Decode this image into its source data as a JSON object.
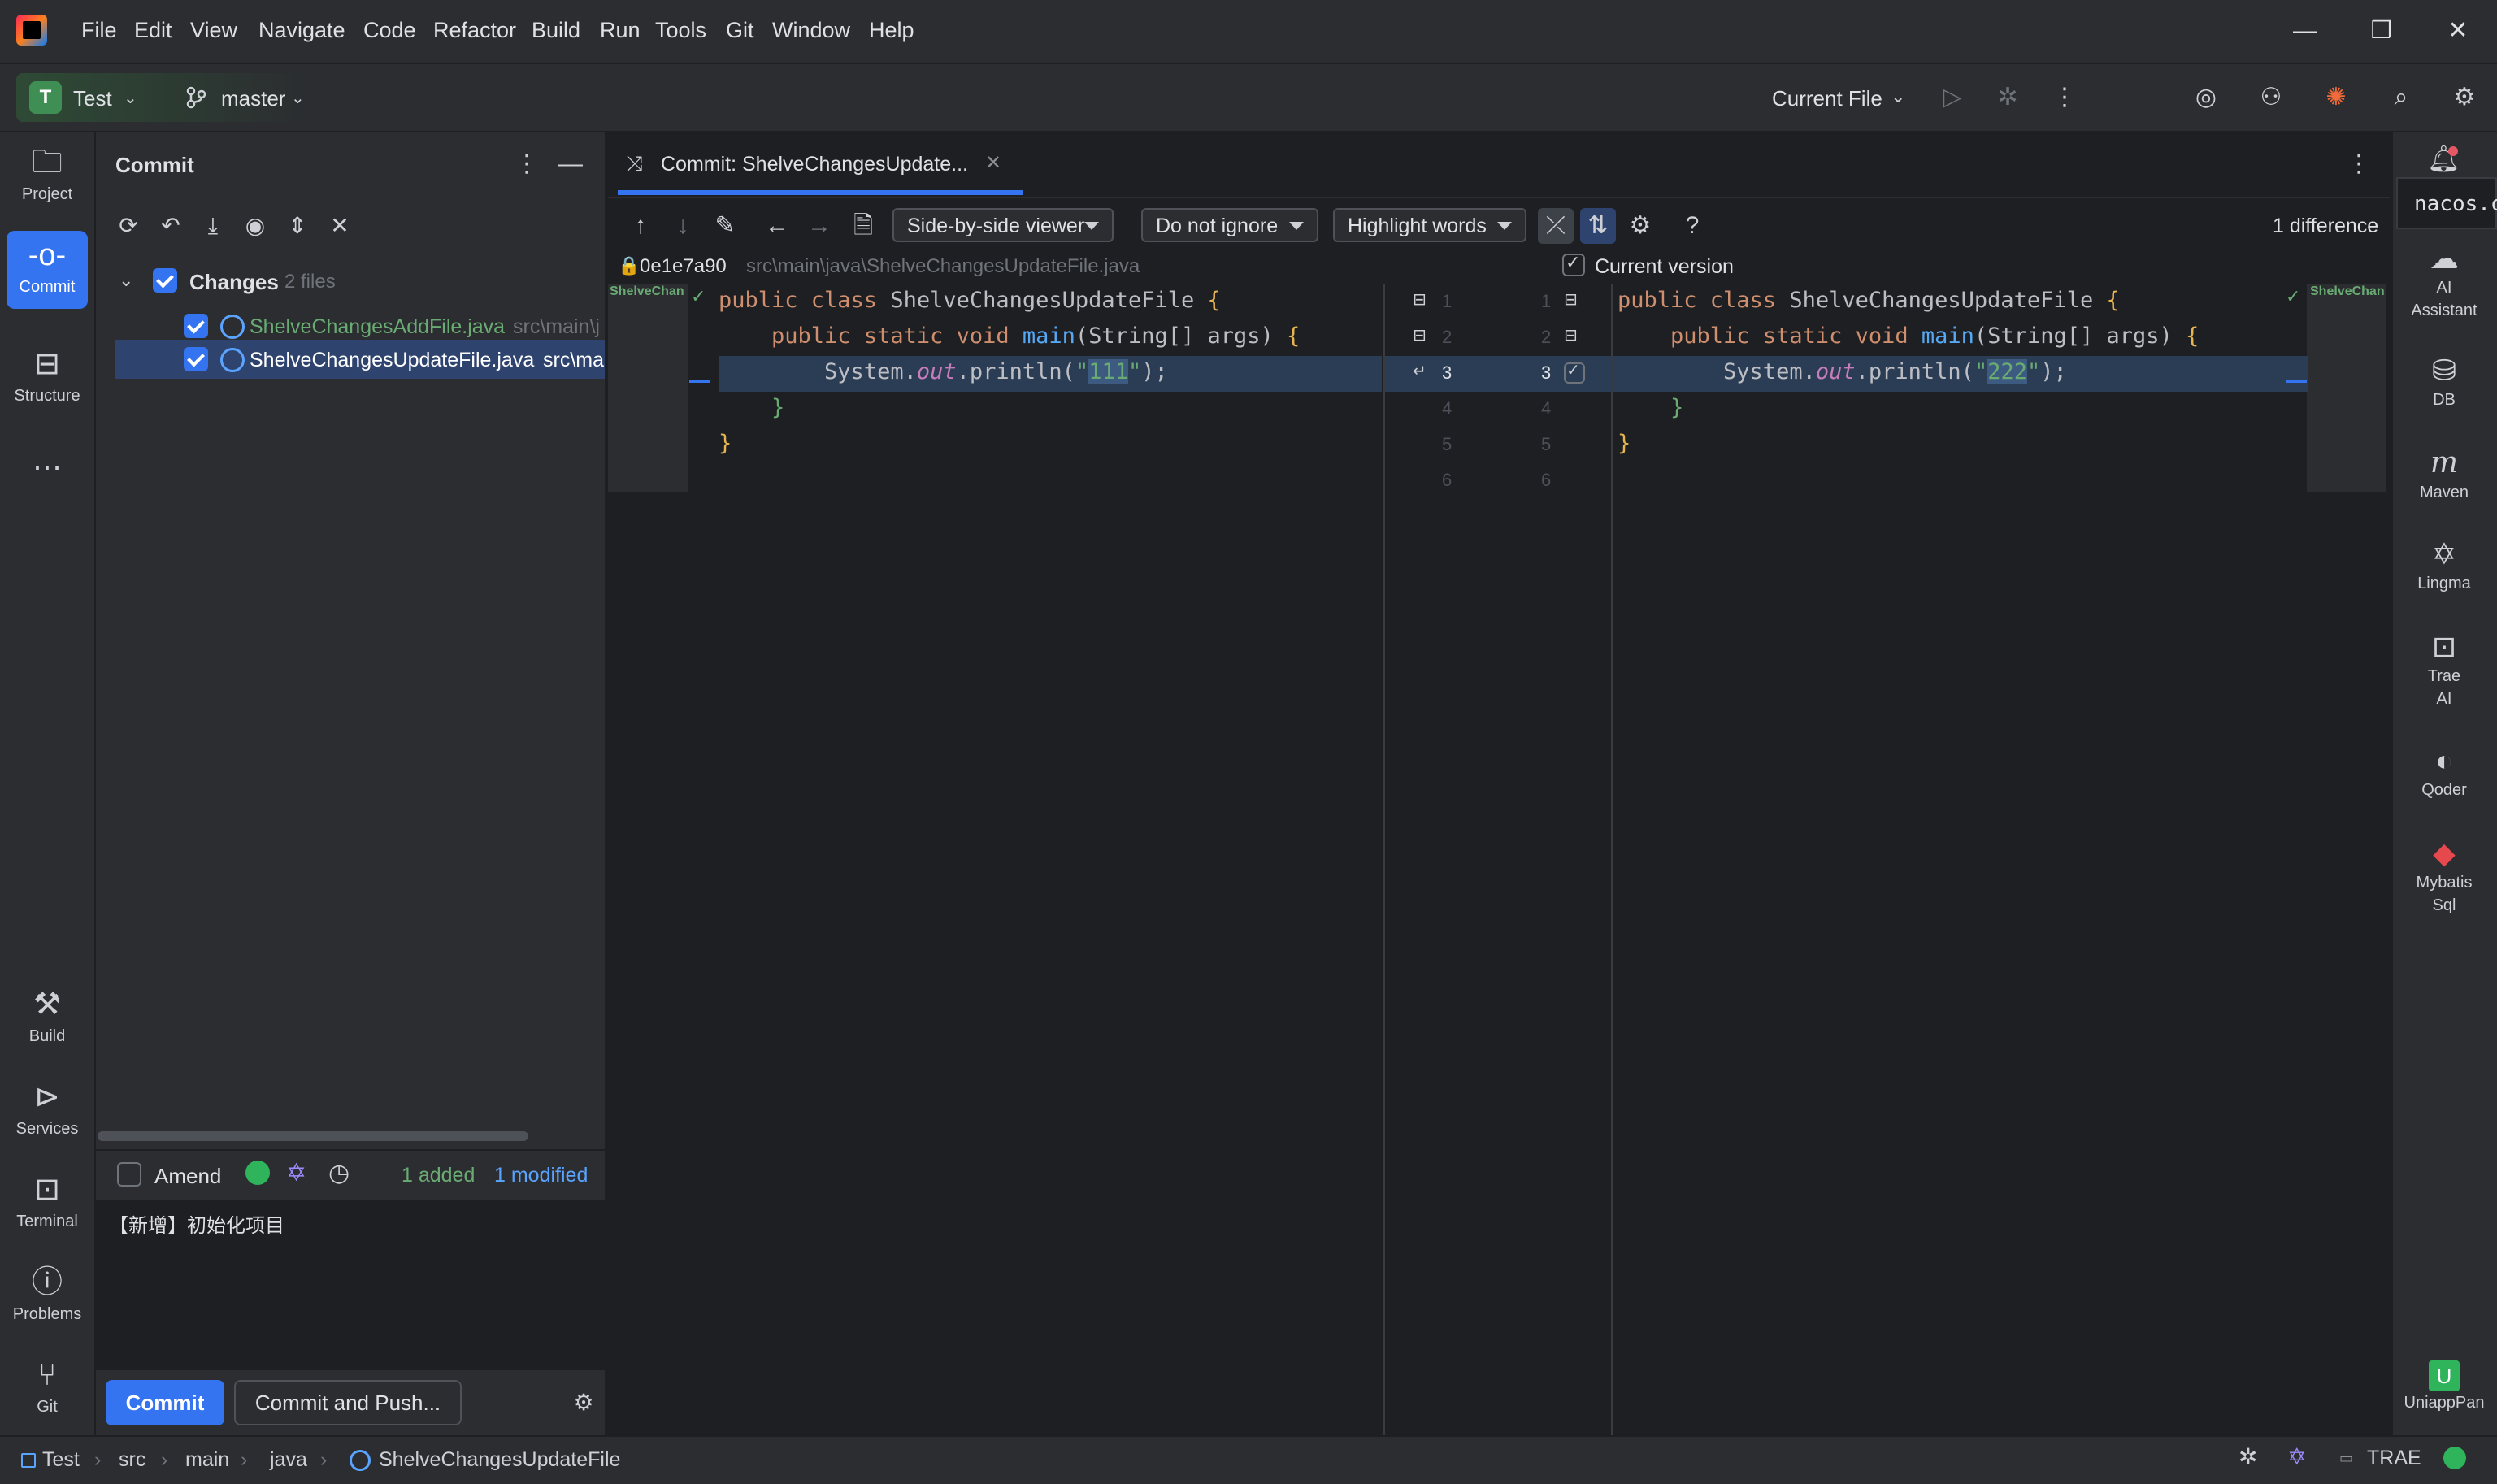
{
  "menu": [
    "File",
    "Edit",
    "View",
    "Navigate",
    "Code",
    "Refactor",
    "Build",
    "Run",
    "Tools",
    "Git",
    "Window",
    "Help"
  ],
  "window_controls": {
    "minimize": "—",
    "restore": "❐",
    "close": "✕"
  },
  "toolbar": {
    "project_badge": "T",
    "project_name": "Test",
    "branch": "master",
    "run_config": "Current File"
  },
  "left_rail": {
    "top": [
      {
        "label": "Project",
        "icon": "folder-icon"
      },
      {
        "label": "Commit",
        "icon": "commit-icon"
      },
      {
        "label": "Structure",
        "icon": "structure-icon"
      },
      {
        "label": "…",
        "icon": "more-icon"
      }
    ],
    "bottom": [
      {
        "label": "Build",
        "icon": "hammer-icon"
      },
      {
        "label": "Services",
        "icon": "services-icon"
      },
      {
        "label": "Terminal",
        "icon": "terminal-icon"
      },
      {
        "label": "Problems",
        "icon": "problems-icon"
      },
      {
        "label": "Git",
        "icon": "git-icon"
      }
    ]
  },
  "commit_panel": {
    "title": "Commit",
    "changes_label": "Changes",
    "changes_count": "2 files",
    "files": [
      {
        "name": "ShelveChangesAddFile.java",
        "path": "src\\main\\j",
        "status_color": "#6aab73"
      },
      {
        "name": "ShelveChangesUpdateFile.java",
        "path": "src\\ma",
        "status_color": "#ffffff"
      }
    ],
    "amend_label": "Amend",
    "added": "1 added",
    "modified": "1 modified",
    "message": "【新增】初始化项目",
    "commit_button": "Commit",
    "commit_push_button": "Commit and Push..."
  },
  "diff": {
    "tab_title": "Commit: ShelveChangesUpdate...",
    "viewer": "Side-by-side viewer",
    "ignore": "Do not ignore",
    "highlight": "Highlight words",
    "difference_count": "1 difference",
    "left_revision": "0e1e7a90",
    "left_path": "src\\main\\java\\ShelveChangesUpdateFile.java",
    "right_label": "Current version",
    "left_tag": "ShelveChan",
    "right_tag": "ShelveChan",
    "left_lines": [
      "1",
      "2",
      "3",
      "4",
      "5",
      "6"
    ],
    "right_lines": [
      "1",
      "2",
      "3",
      "4",
      "5",
      "6"
    ],
    "code_class": "public class ShelveChangesUpdateFile {",
    "code_main": "public static void main(String[] args) {",
    "left_string": "111",
    "right_string": "222"
  },
  "right_rail": [
    {
      "label": "AI\nAssistant",
      "icon": "ai-assistant-icon"
    },
    {
      "label": "DB",
      "icon": "database-icon"
    },
    {
      "label": "Maven",
      "icon": "maven-icon"
    },
    {
      "label": "Lingma",
      "icon": "lingma-icon"
    },
    {
      "label": "Trae\nAI",
      "icon": "trae-icon"
    },
    {
      "label": "Qoder",
      "icon": "qoder-icon"
    },
    {
      "label": "Mybatis\nSql",
      "icon": "mybatis-icon"
    },
    {
      "label": "UniappPan",
      "icon": "uniapp-icon"
    }
  ],
  "popup_text": "nacos.c",
  "statusbar": {
    "breadcrumb": [
      "Test",
      "src",
      "main",
      "java",
      "ShelveChangesUpdateFile"
    ],
    "trae": "TRAE"
  }
}
